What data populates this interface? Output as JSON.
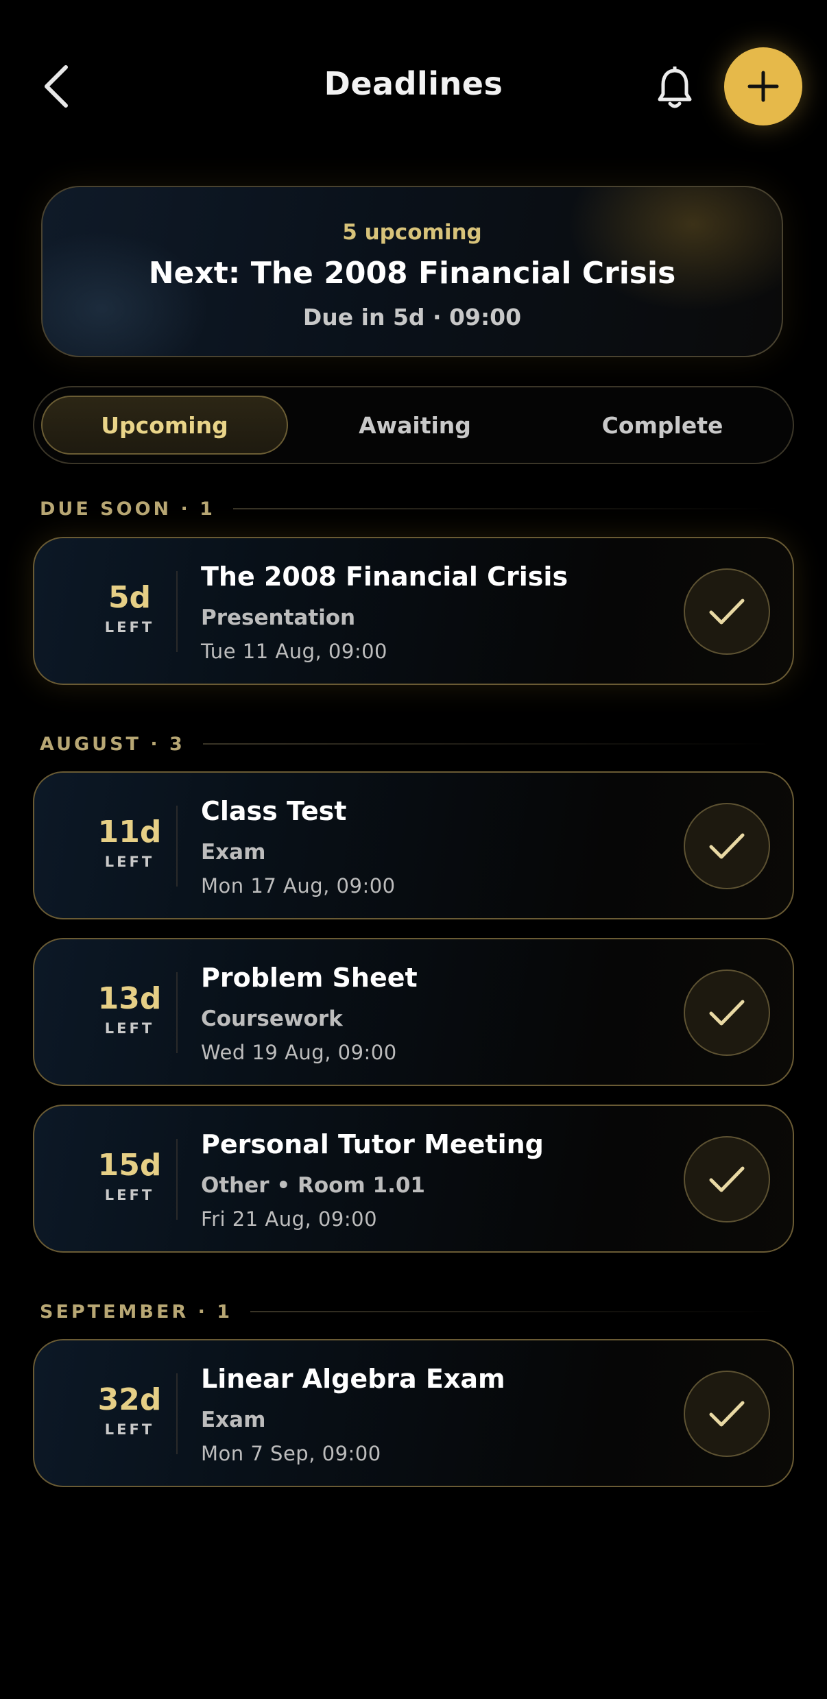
{
  "header": {
    "title": "Deadlines",
    "icons": {
      "back": "chevron-left-icon",
      "bell": "bell-icon",
      "add": "plus-icon"
    }
  },
  "summary": {
    "count_text": "5 upcoming",
    "next_text": "Next: The 2008 Financial Crisis",
    "due_text": "Due in 5d · 09:00"
  },
  "tabs": [
    {
      "label": "Upcoming",
      "active": true
    },
    {
      "label": "Awaiting",
      "active": false
    },
    {
      "label": "Complete",
      "active": false
    }
  ],
  "sections": [
    {
      "label": "DUE SOON · 1",
      "items": [
        {
          "days": "5d",
          "unit": "LEFT",
          "title": "The 2008 Financial Crisis",
          "type": "Presentation",
          "date": "Tue 11 Aug, 09:00"
        }
      ]
    },
    {
      "label": "AUGUST · 3",
      "items": [
        {
          "days": "11d",
          "unit": "LEFT",
          "title": "Class Test",
          "type": "Exam",
          "date": "Mon 17 Aug, 09:00"
        },
        {
          "days": "13d",
          "unit": "LEFT",
          "title": "Problem Sheet",
          "type": "Coursework",
          "date": "Wed 19 Aug, 09:00"
        },
        {
          "days": "15d",
          "unit": "LEFT",
          "title": "Personal Tutor Meeting",
          "type": "Other • Room 1.01",
          "date": "Fri 21 Aug, 09:00"
        }
      ]
    },
    {
      "label": "SEPTEMBER · 1",
      "items": [
        {
          "days": "32d",
          "unit": "LEFT",
          "title": "Linear Algebra Exam",
          "type": "Exam",
          "date": "Mon 7 Sep, 09:00"
        }
      ]
    }
  ],
  "colors": {
    "accent": "#e6b94a",
    "accent_text": "#e6cf86",
    "card_border": "#6a5b34",
    "background": "#000000"
  }
}
